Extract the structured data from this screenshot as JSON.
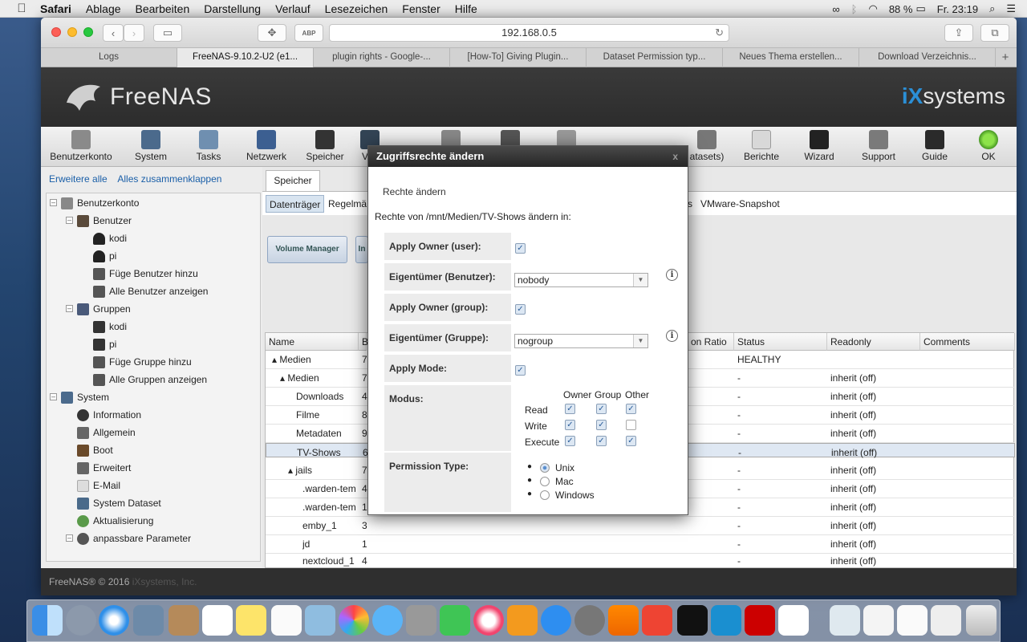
{
  "menubar": {
    "app": "Safari",
    "items": [
      "Ablage",
      "Bearbeiten",
      "Darstellung",
      "Verlauf",
      "Lesezeichen",
      "Fenster",
      "Hilfe"
    ],
    "battery": "88 %",
    "clock": "Fr. 23:19"
  },
  "browser": {
    "url": "192.168.0.5",
    "tabs": [
      "Logs",
      "FreeNAS-9.10.2-U2 (e1...",
      "plugin rights - Google-...",
      "[How-To] Giving Plugin...",
      "Dataset Permission typ...",
      "Neues Thema erstellen...",
      "Download Verzeichnis..."
    ],
    "active_tab": 1
  },
  "freenas": {
    "logo": "FreeNAS",
    "vendor_ix": "iX",
    "vendor_rest": "systems",
    "nav": [
      "Benutzerkonto",
      "System",
      "Tasks",
      "Netzwerk",
      "Speicher",
      "V",
      "",
      "",
      "",
      "atasets)",
      "Berichte",
      "Wizard",
      "Support",
      "Guide",
      "OK"
    ],
    "sidebar_links": [
      "Erweitere alle",
      "Alles zusammenklappen"
    ],
    "tree": [
      {
        "label": "Benutzerkonto",
        "level": 0
      },
      {
        "label": "Benutzer",
        "level": 1
      },
      {
        "label": "kodi",
        "level": 2
      },
      {
        "label": "pi",
        "level": 2
      },
      {
        "label": "Füge Benutzer hinzu",
        "level": 2
      },
      {
        "label": "Alle Benutzer anzeigen",
        "level": 2
      },
      {
        "label": "Gruppen",
        "level": 1
      },
      {
        "label": "kodi",
        "level": 2
      },
      {
        "label": "pi",
        "level": 2
      },
      {
        "label": "Füge Gruppe hinzu",
        "level": 2
      },
      {
        "label": "Alle Gruppen anzeigen",
        "level": 2
      },
      {
        "label": "System",
        "level": 0
      },
      {
        "label": "Information",
        "level": 1
      },
      {
        "label": "Allgemein",
        "level": 1
      },
      {
        "label": "Boot",
        "level": 1
      },
      {
        "label": "Erweitert",
        "level": 1
      },
      {
        "label": "E-Mail",
        "level": 1
      },
      {
        "label": "System Dataset",
        "level": 1
      },
      {
        "label": "Aktualisierung",
        "level": 1
      },
      {
        "label": "anpassbare Parameter",
        "level": 1
      }
    ],
    "main_tab": "Speicher",
    "subtabs": [
      "Datenträger",
      "Regelmä",
      "s",
      "VMware-Snapshot"
    ],
    "buttons": [
      "Volume Manager",
      "In"
    ],
    "grid_headers": [
      "Name",
      "B",
      "on Ratio",
      "Status",
      "Readonly",
      "Comments"
    ],
    "grid_rows": [
      {
        "name": "▴ Medien",
        "b": "7",
        "status": "HEALTHY",
        "ro": ""
      },
      {
        "name": "▴ Medien",
        "b": "7",
        "status": "-",
        "ro": "inherit (off)"
      },
      {
        "name": "Downloads",
        "b": "4",
        "status": "-",
        "ro": "inherit (off)"
      },
      {
        "name": "Filme",
        "b": "8",
        "status": "-",
        "ro": "inherit (off)"
      },
      {
        "name": "Metadaten",
        "b": "9",
        "status": "-",
        "ro": "inherit (off)"
      },
      {
        "name": "TV-Shows",
        "b": "6",
        "status": "-",
        "ro": "inherit (off)"
      },
      {
        "name": "▴ jails",
        "b": "7",
        "status": "-",
        "ro": "inherit (off)"
      },
      {
        "name": ".warden-tem",
        "b": "4",
        "status": "-",
        "ro": "inherit (off)"
      },
      {
        "name": ".warden-tem",
        "b": "1",
        "status": "-",
        "ro": "inherit (off)"
      },
      {
        "name": "emby_1",
        "b": "3",
        "status": "-",
        "ro": "inherit (off)"
      },
      {
        "name": "jd",
        "b": "1",
        "status": "-",
        "ro": "inherit (off)"
      },
      {
        "name": "nextcloud_1",
        "b": "4",
        "status": "-",
        "ro": "inherit (off)"
      }
    ],
    "selected_row": 5,
    "footer": "FreeNAS® © 2016 ",
    "footer_link": "iXsystems, Inc."
  },
  "modal": {
    "title": "Zugriffsrechte ändern",
    "close": "x",
    "section": "Rechte ändern",
    "intro": "Rechte von /mnt/Medien/TV-Shows ändern in:",
    "apply_owner_user": "Apply Owner (user):",
    "owner_user_label": "Eigentümer (Benutzer):",
    "owner_user_value": "nobody",
    "apply_owner_group": "Apply Owner (group):",
    "owner_group_label": "Eigentümer (Gruppe):",
    "owner_group_value": "nogroup",
    "apply_mode": "Apply Mode:",
    "mode_label": "Modus:",
    "mode_cols": [
      "Owner",
      "Group",
      "Other"
    ],
    "mode_rows": [
      {
        "label": "Read",
        "values": [
          true,
          true,
          true
        ]
      },
      {
        "label": "Write",
        "values": [
          true,
          true,
          false
        ]
      },
      {
        "label": "Execute",
        "values": [
          true,
          true,
          true
        ]
      }
    ],
    "perm_label": "Permission Type:",
    "perm_options": [
      "Unix",
      "Mac",
      "Windows"
    ],
    "perm_selected": 0
  },
  "colors": {
    "accent": "#2b8fd6",
    "header": "#2c2c2c"
  }
}
